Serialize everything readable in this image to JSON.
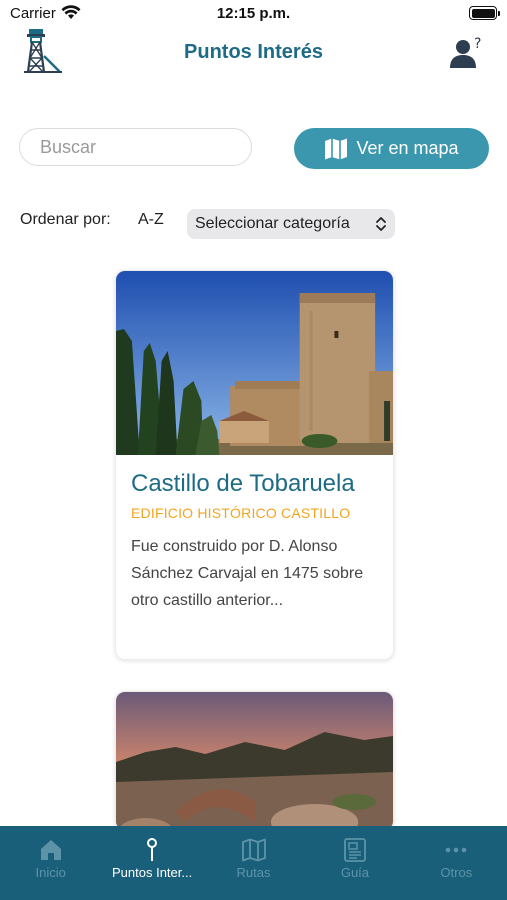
{
  "status_bar": {
    "carrier": "Carrier",
    "time": "12:15 p.m."
  },
  "header": {
    "title": "Puntos Interés"
  },
  "search": {
    "placeholder": "Buscar"
  },
  "map_button": {
    "label": "Ver en mapa"
  },
  "sort": {
    "label": "Ordenar por:",
    "az_label": "A-Z",
    "category_select": "Seleccionar categoría"
  },
  "cards": [
    {
      "title": "Castillo de Tobaruela",
      "category": "EDIFICIO HISTÓRICO CASTILLO",
      "description": "Fue construido por D. Alonso Sánchez Carvajal en 1475 sobre otro castillo anterior..."
    },
    {
      "title": "",
      "category": "",
      "description": ""
    }
  ],
  "tabs": [
    {
      "label": "Inicio",
      "icon": "home-icon",
      "active": false
    },
    {
      "label": "Puntos Inter...",
      "icon": "pin-icon",
      "active": true
    },
    {
      "label": "Rutas",
      "icon": "map-icon",
      "active": false
    },
    {
      "label": "Guía",
      "icon": "guide-icon",
      "active": false
    },
    {
      "label": "Otros",
      "icon": "more-icon",
      "active": false
    }
  ],
  "colors": {
    "accent": "#1e6b86",
    "button": "#3a97ae",
    "category": "#f2a51e",
    "tab_bar": "#1a5f7a"
  }
}
